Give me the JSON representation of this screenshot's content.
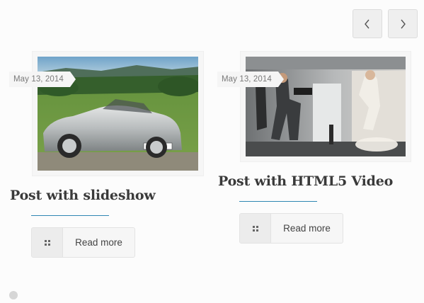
{
  "carousel": {
    "prev_icon": "chevron-left-icon",
    "next_icon": "chevron-right-icon"
  },
  "posts": [
    {
      "date": "May 13, 2014",
      "title": "Post with slideshow",
      "read_more_label": "Read more",
      "read_more_icon": "grid-icon",
      "image": "silver convertible car"
    },
    {
      "date": "May 13, 2014",
      "title": "Post with HTML5 Video",
      "read_more_label": "Read more",
      "read_more_icon": "grid-icon",
      "image": "photo shoot with camera operator"
    }
  ],
  "colors": {
    "accent": "#2f87b3",
    "title_text": "#3a3a3a",
    "date_text": "#7a7a7a"
  }
}
